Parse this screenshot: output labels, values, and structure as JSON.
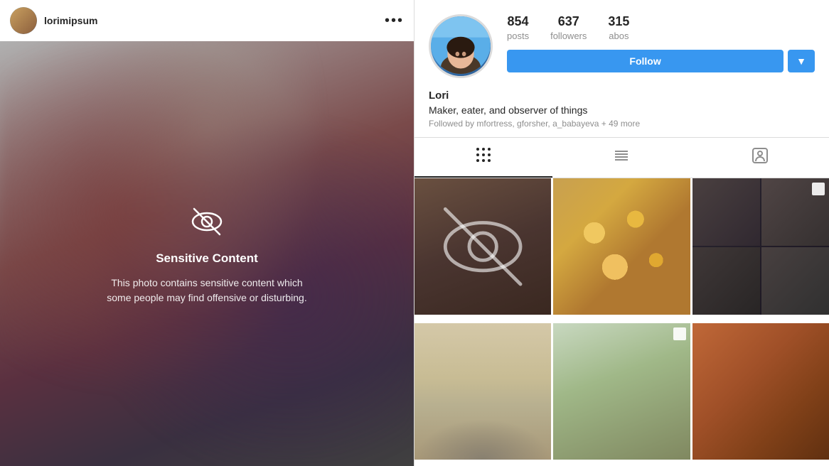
{
  "left": {
    "username": "lorimipsum",
    "more_options_label": "•••",
    "sensitive_content": {
      "icon_label": "eye-slash",
      "title": "Sensitive Content",
      "description": "This photo contains sensitive content which some people may find offensive or disturbing."
    }
  },
  "right": {
    "profile": {
      "name": "Lori",
      "bio": "Maker, eater, and observer of things",
      "followed_by": "Followed by mfortress, gforsher, a_babayeva + 49 more"
    },
    "stats": {
      "posts_count": "854",
      "posts_label": "posts",
      "followers_count": "637",
      "followers_label": "followers",
      "following_count": "315",
      "following_label": "abos"
    },
    "follow_button_label": "Follow",
    "follow_dropdown_char": "▼",
    "tabs": [
      {
        "name": "grid-tab",
        "label": "Grid",
        "active": true
      },
      {
        "name": "list-tab",
        "label": "List",
        "active": false
      },
      {
        "name": "tagged-tab",
        "label": "Tagged",
        "active": false
      }
    ],
    "colors": {
      "follow_button_bg": "#3897f0",
      "follow_button_text": "#ffffff",
      "active_tab_border": "#262626"
    }
  }
}
